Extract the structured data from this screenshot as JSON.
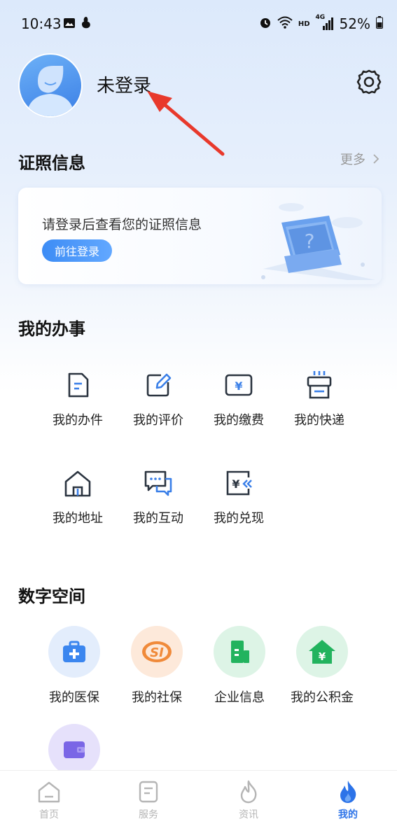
{
  "status_bar": {
    "time": "10:43",
    "battery": "52%",
    "net": "HD",
    "signal": "4G"
  },
  "profile": {
    "name": "未登录"
  },
  "cert": {
    "title": "证照信息",
    "more": "更多",
    "card_text": "请登录后查看您的证照信息",
    "login_button": "前往登录"
  },
  "tasks": {
    "title": "我的办事",
    "items": [
      {
        "label": "我的办件",
        "icon": "document-icon"
      },
      {
        "label": "我的评价",
        "icon": "edit-icon"
      },
      {
        "label": "我的缴费",
        "icon": "payment-icon"
      },
      {
        "label": "我的快递",
        "icon": "delivery-icon"
      },
      {
        "label": "我的地址",
        "icon": "home-icon"
      },
      {
        "label": "我的互动",
        "icon": "chat-icon"
      },
      {
        "label": "我的兑现",
        "icon": "redeem-icon"
      }
    ]
  },
  "space": {
    "title": "数字空间",
    "items": [
      {
        "label": "我的医保",
        "icon": "medical-insurance-icon"
      },
      {
        "label": "我的社保",
        "icon": "social-security-icon"
      },
      {
        "label": "企业信息",
        "icon": "company-icon"
      },
      {
        "label": "我的公积金",
        "icon": "housing-fund-icon"
      },
      {
        "label": "",
        "icon": "wallet-icon"
      }
    ]
  },
  "tabbar": {
    "items": [
      {
        "label": "首页"
      },
      {
        "label": "服务"
      },
      {
        "label": "资讯"
      },
      {
        "label": "我的"
      }
    ],
    "active": 3
  },
  "colors": {
    "accent": "#2c73e8",
    "inactive": "#b5b5b5"
  }
}
